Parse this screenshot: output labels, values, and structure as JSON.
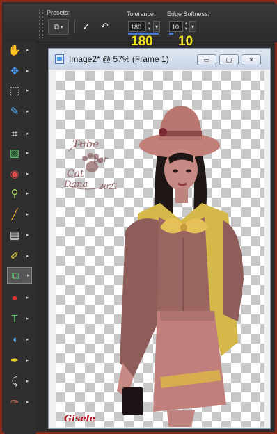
{
  "options_bar": {
    "presets_label": "Presets:",
    "tolerance_label": "Tolerance:",
    "tolerance_value": "180",
    "tolerance_big": "180",
    "edge_softness_label": "Edge Softness:",
    "edge_softness_value": "10",
    "edge_softness_big": "10"
  },
  "tools": [
    {
      "name": "pan-tool",
      "icon": "✋",
      "color": "#f0c890"
    },
    {
      "name": "move-tool",
      "icon": "✥",
      "color": "#4aa0ff"
    },
    {
      "name": "selection-tool",
      "icon": "⬚",
      "color": "#e0e0e0"
    },
    {
      "name": "dropper-tool",
      "icon": "✎",
      "color": "#5fb8ff"
    },
    {
      "name": "crop-tool",
      "icon": "⌗",
      "color": "#ffffff"
    },
    {
      "name": "straighten-tool",
      "icon": "▧",
      "color": "#5fd06f"
    },
    {
      "name": "red-eye-tool",
      "icon": "◉",
      "color": "#e24a4a"
    },
    {
      "name": "makeover-tool",
      "icon": "⚲",
      "color": "#9fd05f"
    },
    {
      "name": "paint-brush-tool",
      "icon": "╱",
      "color": "#f0b030"
    },
    {
      "name": "gradient-tool",
      "icon": "▤",
      "color": "#d0d0d0"
    },
    {
      "name": "eraser-tool",
      "icon": "✐",
      "color": "#f0e040"
    },
    {
      "name": "background-eraser-tool",
      "icon": "⧉",
      "color": "#5fd06f"
    },
    {
      "name": "flood-fill-tool",
      "icon": "●",
      "color": "#e03030"
    },
    {
      "name": "text-tool",
      "icon": "T",
      "color": "#5fd06f"
    },
    {
      "name": "preset-shape-tool",
      "icon": "◖",
      "color": "#5fb8ff"
    },
    {
      "name": "pen-tool",
      "icon": "✒",
      "color": "#f0d040"
    },
    {
      "name": "warp-brush-tool",
      "icon": "⤹",
      "color": "#e0e0e0"
    },
    {
      "name": "clone-brush-tool",
      "icon": "✑",
      "color": "#e08060"
    }
  ],
  "window": {
    "title": "Image2* @  57% (Frame 1)",
    "minimize": "▭",
    "maximize": "▢",
    "close": "✕"
  },
  "watermark": {
    "line1": "Tube",
    "line2": "par",
    "line3": "Cat",
    "line4": "Dana",
    "year": "2021"
  },
  "signature": "Gisele"
}
